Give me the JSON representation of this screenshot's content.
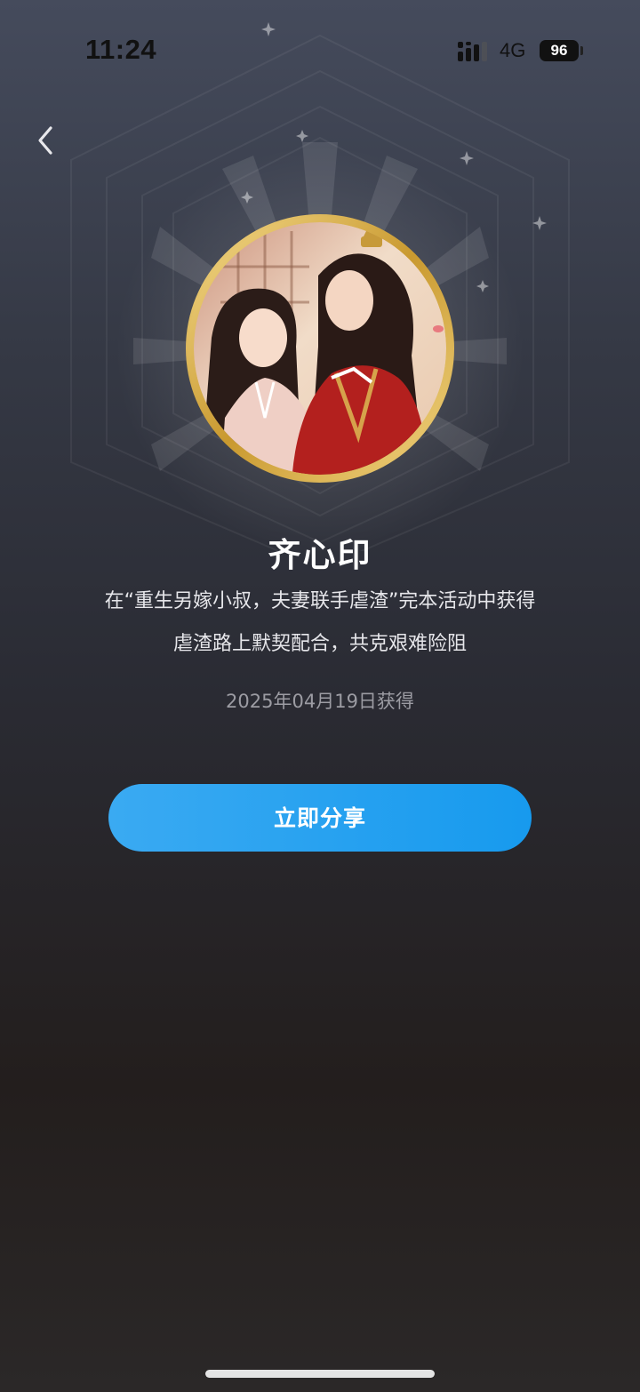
{
  "status_bar": {
    "time": "11:24",
    "network": "4G",
    "battery": "96"
  },
  "badge": {
    "title": "齐心印",
    "description_line1": "在“重生另嫁小叔，夫妻联手虐渣”完本活动中获得",
    "description_line2": "虐渣路上默契配合，共克艰难险阻",
    "obtained_date": "2025年04月19日获得",
    "image": "illustration-couple-ancient-costume"
  },
  "actions": {
    "share_label": "立即分享"
  },
  "icons": {
    "back": "chevron-left-icon",
    "signal": "signal-bars-icon",
    "battery": "battery-icon"
  },
  "colors": {
    "accent": "#1e9cef",
    "ring_gold": "#d9b45a",
    "title": "#ffffff",
    "date": "#9c9ca3"
  }
}
